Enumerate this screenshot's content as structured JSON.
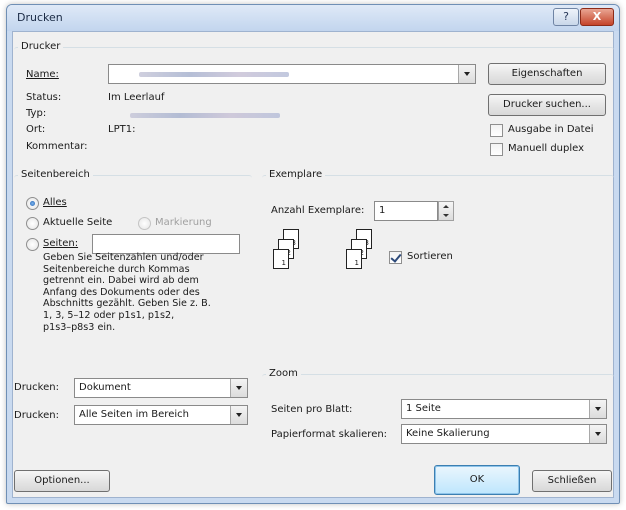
{
  "window": {
    "title": "Drucken",
    "help_button": "?",
    "close_button": "X"
  },
  "printer": {
    "group_title": "Drucker",
    "name_label": "Name:",
    "status_label": "Status:",
    "status_value": "Im Leerlauf",
    "type_label": "Typ:",
    "location_label": "Ort:",
    "location_value": "LPT1:",
    "comment_label": "Kommentar:",
    "properties_button": "Eigenschaften",
    "find_printer_button": "Drucker suchen...",
    "print_to_file_label": "Ausgabe in Datei",
    "manual_duplex_label": "Manuell duplex"
  },
  "page_range": {
    "group_title": "Seitenbereich",
    "all_label": "Alles",
    "current_page_label": "Aktuelle Seite",
    "selection_label": "Markierung",
    "pages_label": "Seiten:",
    "pages_value": "",
    "help_text": "Geben Sie Seitenzahlen und/oder\nSeitenbereiche durch Kommas\ngetrennt ein. Dabei wird ab dem\nAnfang des Dokuments oder des\nAbschnitts gezählt. Geben Sie z. B.\n1, 3, 5–12 oder p1s1, p1s2,\np1s3–p8s3 ein."
  },
  "copies": {
    "group_title": "Exemplare",
    "count_label": "Anzahl Exemplare:",
    "count_value": "1",
    "collate_label": "Sortieren",
    "collate_checked": true,
    "page_numbers": [
      "3",
      "2",
      "1",
      "3",
      "2",
      "1"
    ]
  },
  "print_what": {
    "label": "Drucken:",
    "value": "Dokument"
  },
  "print_range": {
    "label": "Drucken:",
    "value": "Alle Seiten im Bereich"
  },
  "zoom": {
    "group_title": "Zoom",
    "pages_per_sheet_label": "Seiten pro Blatt:",
    "pages_per_sheet_value": "1 Seite",
    "scale_label": "Papierformat skalieren:",
    "scale_value": "Keine Skalierung"
  },
  "footer": {
    "options_button": "Optionen...",
    "ok_button": "OK",
    "close_button": "Schließen"
  }
}
